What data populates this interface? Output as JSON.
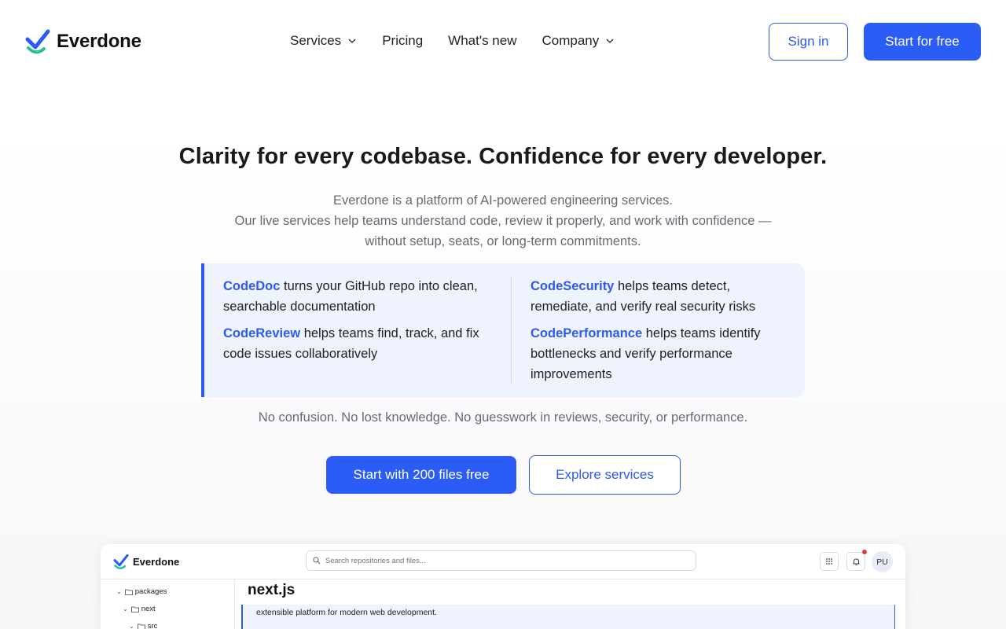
{
  "brand": {
    "name": "Everdone",
    "primary_color": "#2b5cf6",
    "accent_green": "#27c29a"
  },
  "nav": {
    "items": [
      {
        "label": "Services",
        "has_dropdown": true
      },
      {
        "label": "Pricing",
        "has_dropdown": false
      },
      {
        "label": "What's new",
        "has_dropdown": false
      },
      {
        "label": "Company",
        "has_dropdown": true
      }
    ],
    "sign_in": "Sign in",
    "start_free": "Start for free"
  },
  "hero": {
    "title": "Clarity for every codebase. Confidence for every developer.",
    "subtitle_lines": [
      "Everdone is a platform of AI-powered engineering services.",
      "Our live services help teams understand code, review it properly, and work with confidence —",
      "without setup, seats, or long-term commitments."
    ]
  },
  "services": [
    {
      "name": "CodeDoc",
      "desc": " turns your GitHub repo into clean, searchable documentation"
    },
    {
      "name": "CodeReview",
      "desc": " helps teams find, track, and fix code issues collaboratively"
    },
    {
      "name": "CodeSecurity",
      "desc": " helps teams detect, remediate, and verify real security risks"
    },
    {
      "name": "CodePerformance",
      "desc": " helps teams identify bottlenecks and verify performance improvements"
    }
  ],
  "tagline": "No confusion. No lost knowledge. No guesswork in reviews, security, or performance.",
  "cta": {
    "primary": "Start with 200 files free",
    "secondary": "Explore services"
  },
  "preview": {
    "brand": "Everdone",
    "search_placeholder": "Search repositories and files...",
    "avatar": "PU",
    "has_notification": true,
    "tree": [
      "packages",
      "next",
      "src"
    ],
    "title": "next.js",
    "description": "extensible platform for modern web development."
  }
}
